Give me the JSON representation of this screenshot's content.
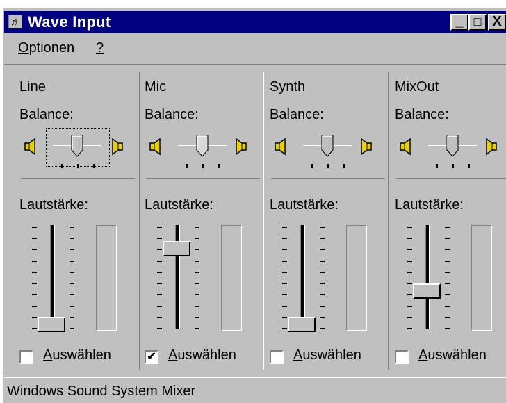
{
  "window": {
    "title": "Wave Input",
    "icon": "mixer-app-icon",
    "controls": {
      "minimize": "_",
      "maximize": "□",
      "close": "X"
    }
  },
  "menu": [
    {
      "label": "Optionen",
      "accelerator": "O",
      "rest": "ptionen"
    },
    {
      "label": "?",
      "accelerator": "?",
      "rest": ""
    }
  ],
  "labels": {
    "balance": "Balance:",
    "volume": "Lautstärke:",
    "select_accelerator": "A",
    "select_rest": "uswählen"
  },
  "channels": [
    {
      "name": "Line",
      "balance": 0.5,
      "volume": 0.0,
      "selected": false,
      "focused": true
    },
    {
      "name": "Mic",
      "balance": 0.5,
      "volume": 0.8,
      "selected": true,
      "focused": false
    },
    {
      "name": "Synth",
      "balance": 0.5,
      "volume": 0.0,
      "selected": false,
      "focused": false
    },
    {
      "name": "MixOut",
      "balance": 0.5,
      "volume": 0.35,
      "selected": false,
      "focused": false
    }
  ],
  "status": {
    "text": "Windows Sound System Mixer"
  },
  "colors": {
    "titlebar": "#000080",
    "face": "#c0c0c0",
    "speaker": "#e8d000"
  }
}
